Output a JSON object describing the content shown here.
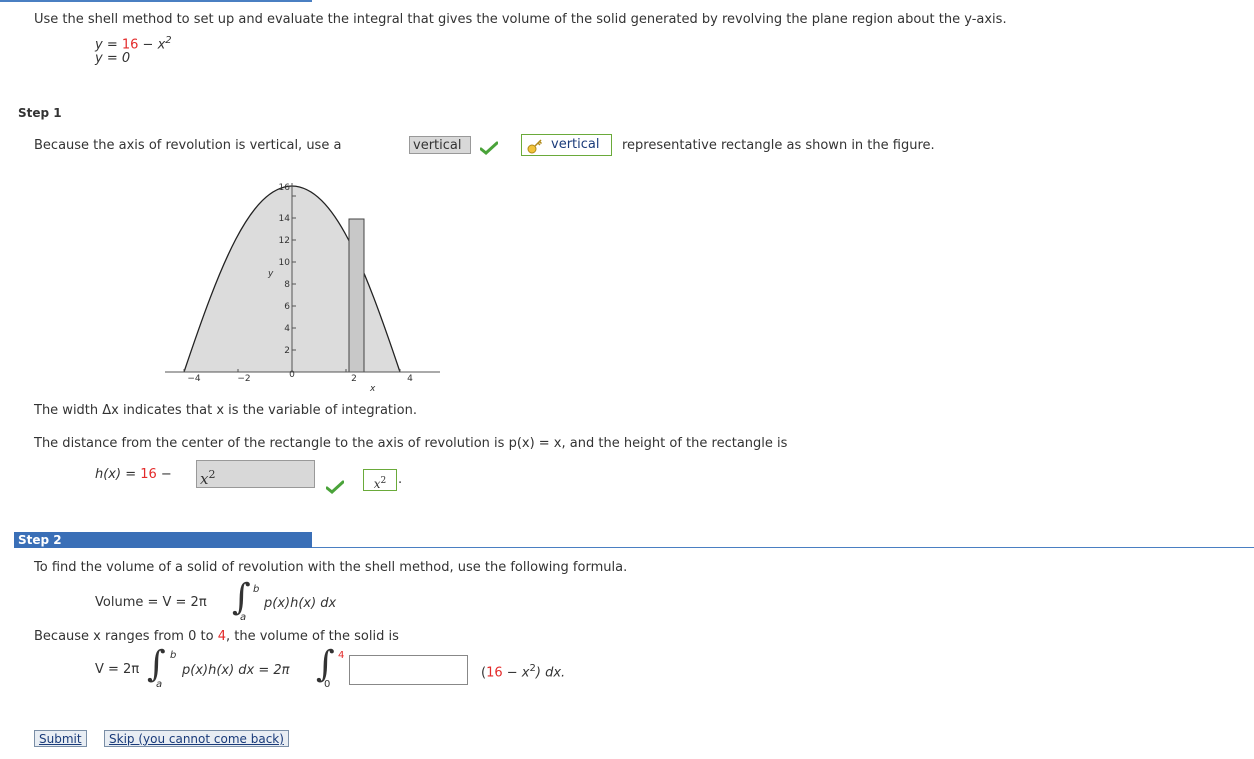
{
  "question": {
    "prompt": "Use the shell method to set up and evaluate the integral that gives the volume of the solid generated by revolving the plane region about the y-axis.",
    "eq1_left": "y = ",
    "eq1_red": "16",
    "eq1_right": " − x",
    "eq1_exp": "2",
    "eq2": "y = 0"
  },
  "step1": {
    "label": "Step 1",
    "sentence_before": "Because the axis of revolution is vertical, use a",
    "answer": "vertical",
    "key_answer": "vertical",
    "sentence_after": "representative rectangle as shown in the figure.",
    "width_text": "The width Δx indicates that x is the variable of integration.",
    "distance_text": "The distance from the center of the rectangle to the axis of revolution is p(x) = x, and the height of the rectangle is",
    "hx_left": "h(x) = ",
    "hx_red": "16",
    "hx_right": " − ",
    "hx_answer": "x",
    "hx_answer_exp": "2",
    "hx_key": "x",
    "hx_key_exp": "2"
  },
  "graph": {
    "x_axis_label": "x",
    "y_axis_label": "y",
    "x_ticks": [
      "−4",
      "−2",
      "0",
      "2",
      "4"
    ],
    "y_ticks": [
      "2",
      "4",
      "6",
      "8",
      "10",
      "12",
      "14",
      "16"
    ]
  },
  "step2": {
    "label": "Step 2",
    "intro": "To find the volume of a solid of revolution with the shell method, use the following formula.",
    "vol_left": "Volume = V = 2π",
    "upper_b": "b",
    "lower_a": "a",
    "integrand": "p(x)h(x) dx",
    "range_text_1": "Because x ranges from 0 to ",
    "range_red": "4",
    "range_text_2": ", the volume of the solid is",
    "v_left": "V = 2π",
    "v_integrand": "p(x)h(x) dx = 2π",
    "upper_4": "4",
    "lower_0": "0",
    "tail_open": "(",
    "tail_red": "16",
    "tail_mid": " − x",
    "tail_exp": "2",
    "tail_close": ") dx."
  },
  "buttons": {
    "submit": "Submit",
    "skip": "Skip (you cannot come back)"
  },
  "colors": {
    "accent": "#3a6fb7",
    "highlight_red": "#e32a2a",
    "check_green": "#4aa33a"
  }
}
